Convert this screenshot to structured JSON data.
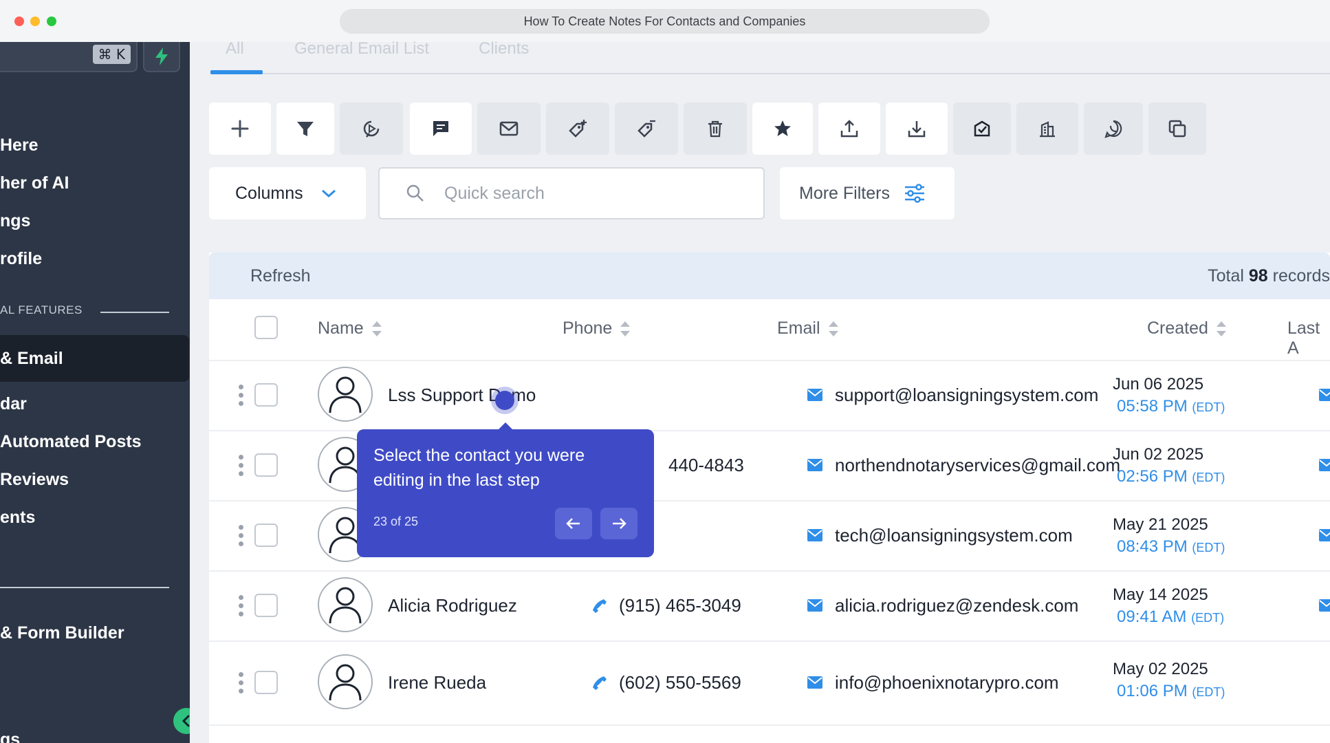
{
  "window": {
    "title": "How To Create Notes For Contacts and Companies"
  },
  "sidebar": {
    "search_shortcut": "⌘ K",
    "items": [
      {
        "label": "Here"
      },
      {
        "label": "her of AI"
      },
      {
        "label": "ngs"
      },
      {
        "label": "rofile"
      },
      {
        "label": "& Email"
      },
      {
        "label": "dar"
      },
      {
        "label": "Automated Posts"
      },
      {
        "label": "Reviews"
      },
      {
        "label": "ents"
      },
      {
        "label": "& Form Builder"
      },
      {
        "label": "gs"
      }
    ],
    "section_label": "AL FEATURES",
    "active_item": "& Email"
  },
  "tabs": [
    "All",
    "General Email List",
    "Clients"
  ],
  "toolbar": {
    "icons": [
      "add-icon",
      "filter-icon",
      "play-circle-icon",
      "message-icon",
      "mail-icon",
      "tag-add-icon",
      "tag-remove-icon",
      "trash-icon",
      "star-icon",
      "upload-icon",
      "download-icon",
      "mailbox-check-icon",
      "building-icon",
      "whatsapp-icon",
      "duplicate-icon"
    ]
  },
  "controls": {
    "columns_label": "Columns",
    "search_placeholder": "Quick search",
    "more_filters_label": "More Filters"
  },
  "table": {
    "refresh_label": "Refresh",
    "total_prefix": "Total",
    "total_count": "98",
    "total_suffix": "records",
    "headers": {
      "name": "Name",
      "phone": "Phone",
      "email": "Email",
      "created": "Created",
      "last": "Last A"
    },
    "rows": [
      {
        "name": "Lss Support Demo",
        "phone": "",
        "email": "support@loansigningsystem.com",
        "date": "Jun 06 2025",
        "time": "05:58 PM",
        "tz": "(EDT)"
      },
      {
        "name": "",
        "phone": "440-4843",
        "email": "northendnotaryservices@gmail.com",
        "date": "Jun 02 2025",
        "time": "02:56 PM",
        "tz": "(EDT)"
      },
      {
        "name": "",
        "phone": "",
        "email": "tech@loansigningsystem.com",
        "date": "May 21 2025",
        "time": "08:43 PM",
        "tz": "(EDT)"
      },
      {
        "name": "Alicia Rodriguez",
        "phone": "(915) 465-3049",
        "email": "alicia.rodriguez@zendesk.com",
        "date": "May 14 2025",
        "time": "09:41 AM",
        "tz": "(EDT)"
      },
      {
        "name": "Irene Rueda",
        "phone": "(602) 550-5569",
        "email": "info@phoenixnotarypro.com",
        "date": "May 02 2025",
        "time": "01:06 PM",
        "tz": "(EDT)"
      }
    ]
  },
  "tooltip": {
    "text": "Select the contact you were editing in the last step",
    "step": "23 of 25"
  },
  "colors": {
    "accent": "#2f8ee8",
    "tooltip": "#3f4bc6",
    "sidebar": "#2d3646"
  }
}
